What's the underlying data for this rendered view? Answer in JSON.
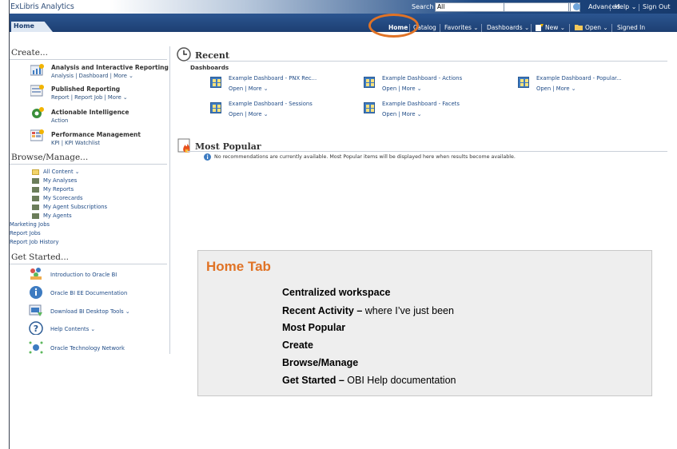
{
  "header": {
    "brand": "ExLibris Analytics",
    "search_label": "Search",
    "search_scope": "All",
    "advanced": "Advanced",
    "help": "Help ⌄",
    "sign_out": "Sign Out"
  },
  "nav": {
    "home_tab": "Home",
    "home": "Home",
    "catalog": "Catalog",
    "favorites": "Favorites ⌄",
    "dashboards": "Dashboards ⌄",
    "new": "New ⌄",
    "open": "Open ⌄",
    "signed_in": "Signed In"
  },
  "left": {
    "create_heading": "Create...",
    "create_items": [
      {
        "icon": "analysis-icon",
        "title": "Analysis and Interactive Reporting",
        "links": "Analysis | Dashboard | More ⌄"
      },
      {
        "icon": "published-reporting-icon",
        "title": "Published Reporting",
        "links": "Report | Report Job | More ⌄"
      },
      {
        "icon": "actionable-intelligence-icon",
        "title": "Actionable Intelligence",
        "links": "Action"
      },
      {
        "icon": "performance-management-icon",
        "title": "Performance Management",
        "links": "KPI | KPI Watchlist"
      }
    ],
    "browse_heading": "Browse/Manage...",
    "browse_items": [
      "All Content ⌄",
      "My Analyses",
      "My Reports",
      "My Scorecards",
      "My Agent Subscriptions",
      "My Agents",
      "Marketing Jobs",
      "Report Jobs",
      "Report Job History"
    ],
    "get_started_heading": "Get Started...",
    "get_started_items": [
      "Introduction to Oracle BI",
      "Oracle BI EE Documentation",
      "Download BI Desktop Tools ⌄",
      "Help Contents ⌄",
      "Oracle Technology Network"
    ]
  },
  "main": {
    "recent_heading": "Recent",
    "dashboards_label": "Dashboards",
    "open_more": "Open | More ⌄",
    "recent_items": [
      "Example Dashboard - PNX Rec...",
      "Example Dashboard - Actions",
      "Example Dashboard - Popular...",
      "Example Dashboard - Sessions",
      "Example Dashboard - Facets"
    ],
    "popular_heading": "Most Popular",
    "popular_info": "No recommendations are currently available. Most Popular items will be displayed here when results become available."
  },
  "callout": {
    "title": "Home Tab",
    "lines": [
      {
        "bold": "Centralized workspace",
        "rest": ""
      },
      {
        "bold": "Recent Activity –",
        "rest": " where I’ve just been"
      },
      {
        "bold": "Most Popular",
        "rest": ""
      },
      {
        "bold": "Create",
        "rest": ""
      },
      {
        "bold": "Browse/Manage",
        "rest": ""
      },
      {
        "bold": "Get Started –",
        "rest": " OBI Help documentation"
      }
    ]
  },
  "colors": {
    "accent_orange": "#e07326",
    "nav_blue": "#1d3f72",
    "link_blue": "#1f4b87"
  }
}
